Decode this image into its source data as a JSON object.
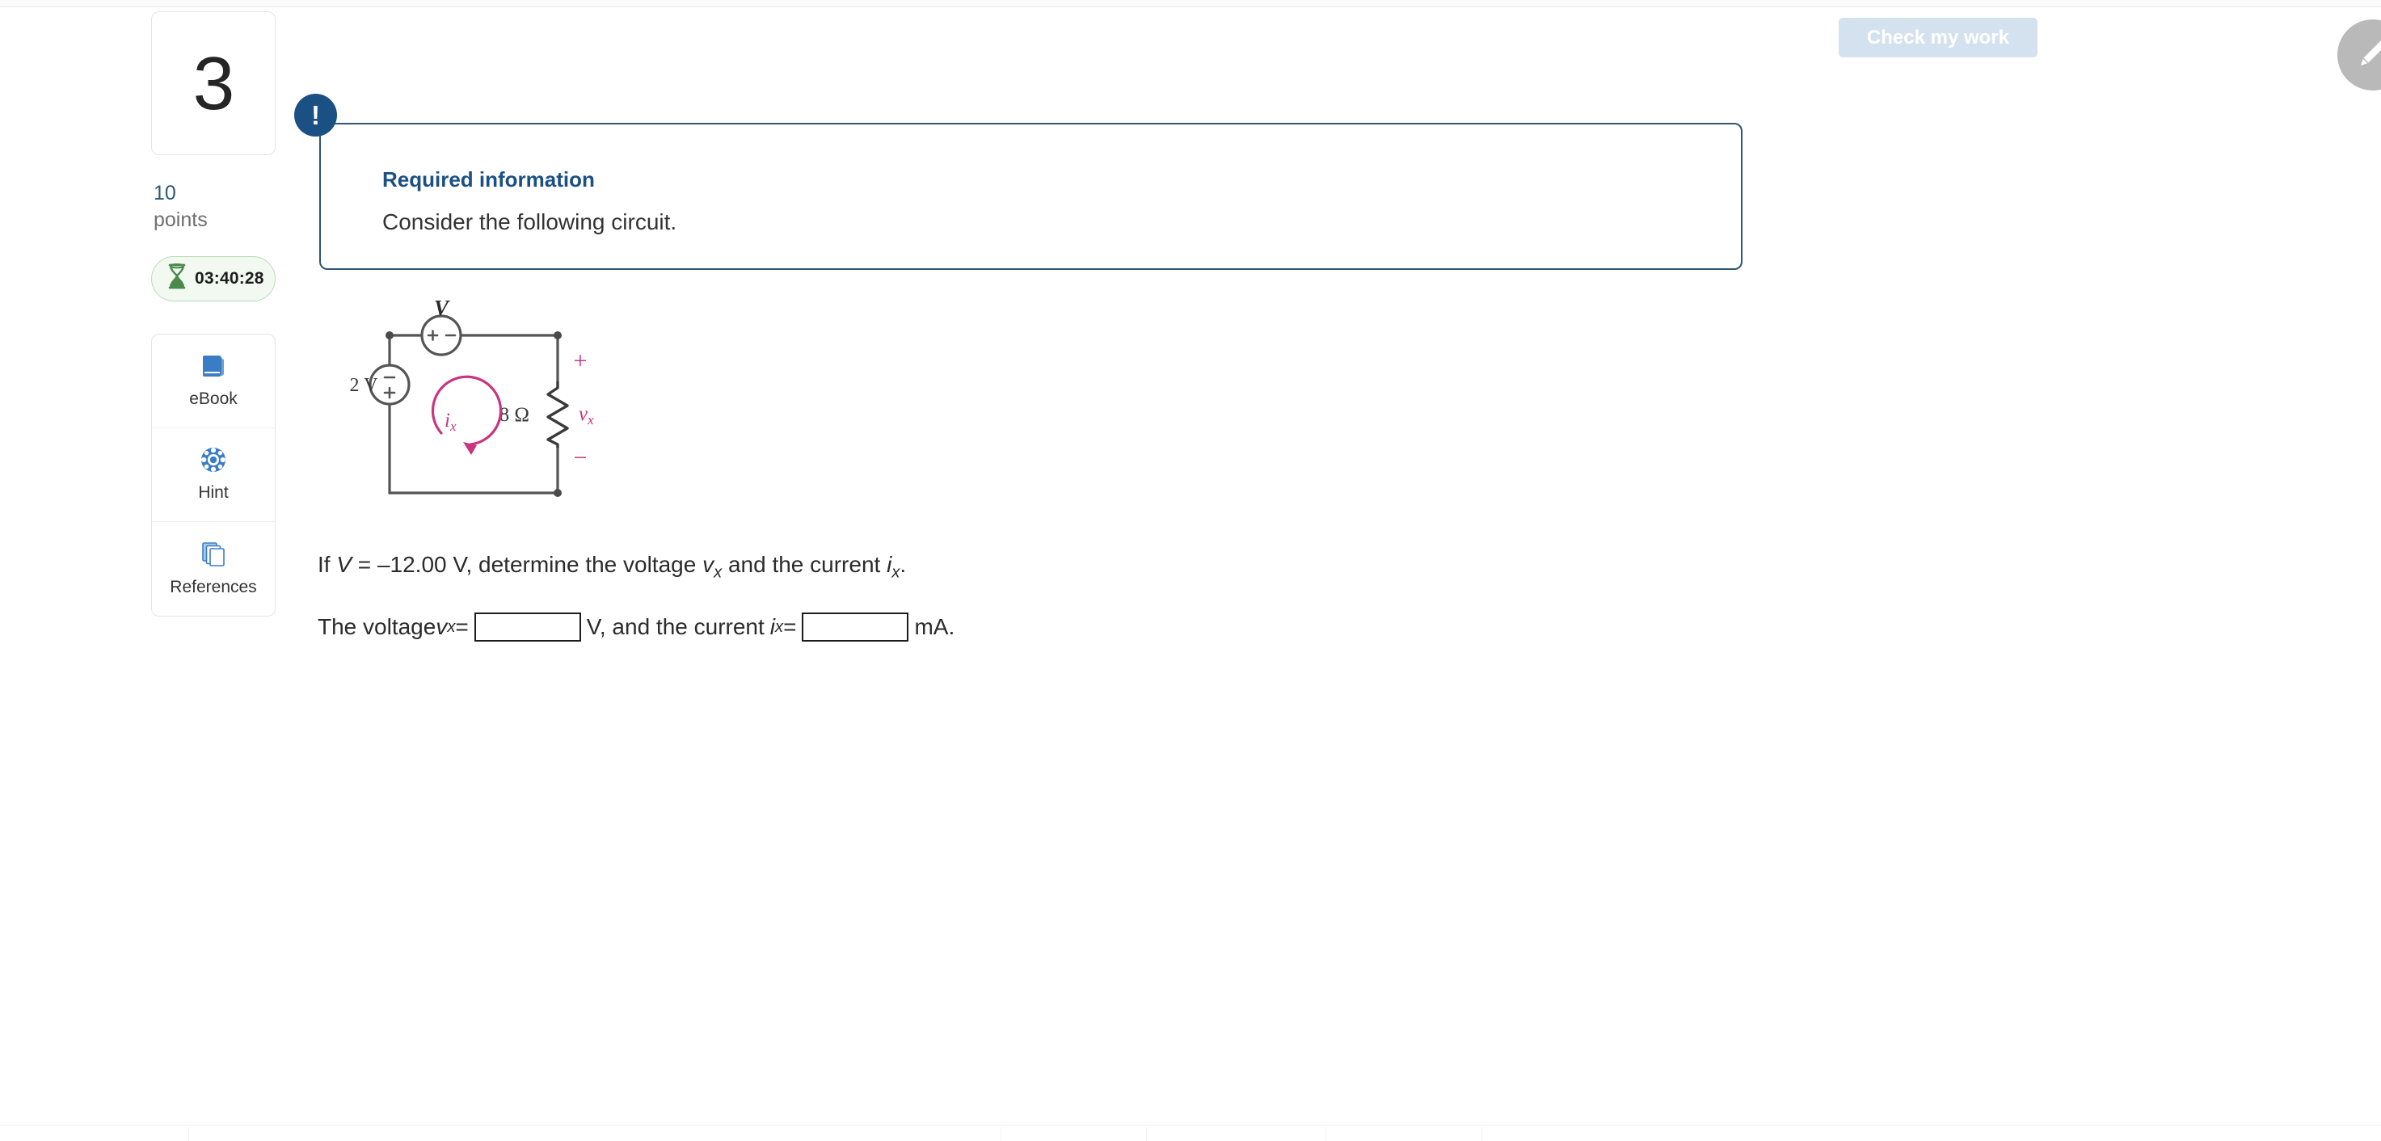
{
  "header": {
    "check_button_label": "Check my work",
    "pencil_icon": "pencil-icon"
  },
  "sidebar": {
    "question_number": "3",
    "points_value": "10",
    "points_label": "points",
    "timer": "03:40:28",
    "timer_icon": "hourglass-icon",
    "tools": [
      {
        "label": "eBook",
        "icon": "book-icon"
      },
      {
        "label": "Hint",
        "icon": "life-ring-icon"
      },
      {
        "label": "References",
        "icon": "stacked-pages-icon"
      }
    ]
  },
  "banner": {
    "icon": "exclamation-icon",
    "bang": "!",
    "title": "Required information",
    "body": "Consider the following circuit."
  },
  "figure": {
    "caption": "circuit-diagram",
    "source_v_label": "V",
    "source_v_plus": "+",
    "source_v_minus": "−",
    "source_2v_label": "2 V",
    "source_2v_minus": "−",
    "source_2v_plus": "+",
    "resistor_label": "8 Ω",
    "current_label": "i",
    "current_sub": "x",
    "vx_label": "v",
    "vx_sub": "x",
    "vx_plus": "+",
    "vx_minus": "−",
    "accent_color": "#c9357f",
    "wire_color": "#555555"
  },
  "prompt": {
    "p1": "If ",
    "var_v": "V",
    "p2": " = –12.00 V, determine the voltage ",
    "var_vx": "v",
    "var_vx_sub": "x",
    "p3": " and the current ",
    "var_ix": "i",
    "var_ix_sub": "x",
    "p4": "."
  },
  "answer": {
    "a1": "The voltage ",
    "var_vx": "v",
    "var_vx_sub": "x",
    "eq1": " = ",
    "voltage_value": "",
    "voltage_placeholder": "",
    "unit1": "V, and the current ",
    "var_ix": "i",
    "var_ix_sub": "x",
    "eq2": " = ",
    "current_value": "",
    "current_placeholder": "",
    "unit2": "mA."
  },
  "colors": {
    "banner_border": "#2d5574",
    "banner_accent": "#1b5084",
    "points_blue": "#2c5777",
    "timer_green": "#4c8a4c",
    "tool_blue": "#3b7dc4",
    "check_disabled": "#d4e2f0"
  }
}
